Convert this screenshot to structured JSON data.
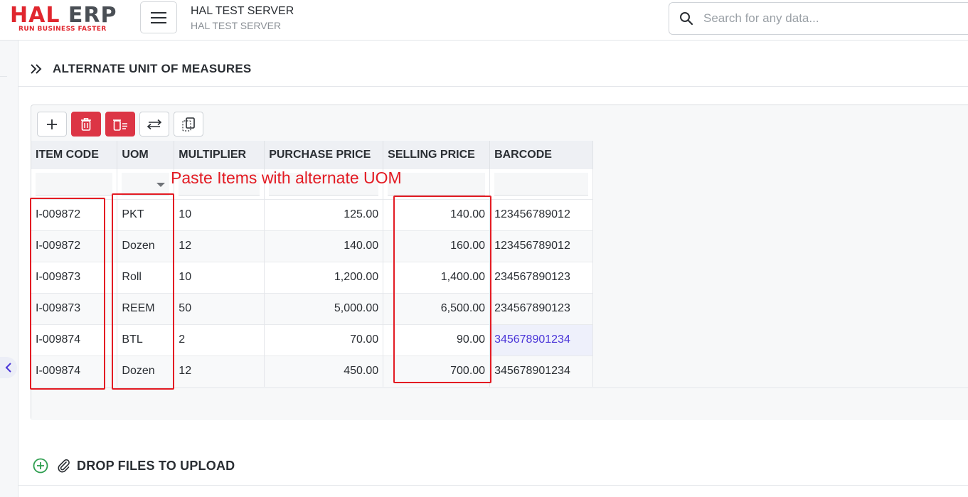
{
  "logo": {
    "brand_left": "HAL",
    "brand_right": "ERP",
    "tagline": "RUN BUSINESS FASTER"
  },
  "header": {
    "server_title": "HAL TEST SERVER",
    "server_subtitle": "HAL TEST SERVER"
  },
  "search": {
    "placeholder": "Search for any data..."
  },
  "section": {
    "title": "ALTERNATE UNIT OF MEASURES"
  },
  "toolbar": {
    "buttons": [
      {
        "name": "add",
        "icon": "plus-icon"
      },
      {
        "name": "delete",
        "icon": "trash-icon"
      },
      {
        "name": "delete-rows",
        "icon": "trash-list-icon"
      },
      {
        "name": "swap",
        "icon": "swap-arrows-icon"
      },
      {
        "name": "copy",
        "icon": "copy-icon"
      }
    ]
  },
  "grid": {
    "columns": [
      "ITEM CODE",
      "UOM",
      "MULTIPLIER",
      "PURCHASE PRICE",
      "SELLING PRICE",
      "BARCODE"
    ],
    "rows": [
      {
        "item_code": "I-009872",
        "uom": "PKT",
        "multiplier": "10",
        "purchase_price": "125.00",
        "selling_price": "140.00",
        "barcode": "123456789012"
      },
      {
        "item_code": "I-009872",
        "uom": "Dozen",
        "multiplier": "12",
        "purchase_price": "140.00",
        "selling_price": "160.00",
        "barcode": "123456789012"
      },
      {
        "item_code": "I-009873",
        "uom": "Roll",
        "multiplier": "10",
        "purchase_price": "1,200.00",
        "selling_price": "1,400.00",
        "barcode": "234567890123"
      },
      {
        "item_code": "I-009873",
        "uom": "REEM",
        "multiplier": "50",
        "purchase_price": "5,000.00",
        "selling_price": "6,500.00",
        "barcode": "234567890123"
      },
      {
        "item_code": "I-009874",
        "uom": "BTL",
        "multiplier": "2",
        "purchase_price": "70.00",
        "selling_price": "90.00",
        "barcode": "345678901234"
      },
      {
        "item_code": "I-009874",
        "uom": "Dozen",
        "multiplier": "12",
        "purchase_price": "450.00",
        "selling_price": "700.00",
        "barcode": "345678901234"
      }
    ]
  },
  "annotation": {
    "text": "Paste Items with alternate UOM",
    "color": "#e31b23"
  },
  "attachments": {
    "label": "DROP FILES TO UPLOAD"
  },
  "colors": {
    "brand_red": "#e0262e",
    "danger": "#dc3545",
    "add_green": "#2e9e4f",
    "link_purple": "#4a35d8"
  }
}
